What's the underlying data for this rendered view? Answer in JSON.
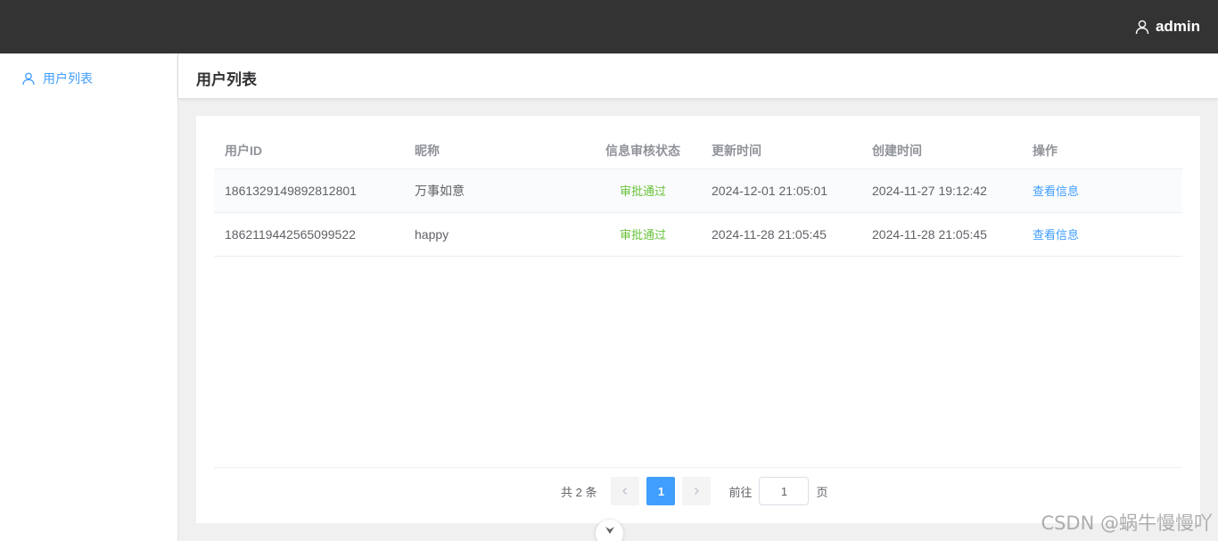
{
  "header": {
    "username": "admin"
  },
  "sidebar": {
    "items": [
      {
        "label": "用户列表",
        "icon": "user-icon"
      }
    ]
  },
  "page": {
    "title": "用户列表"
  },
  "table": {
    "columns": [
      "用户ID",
      "昵称",
      "信息审核状态",
      "更新时间",
      "创建时间",
      "操作"
    ],
    "rows": [
      {
        "id": "1861329149892812801",
        "nickname": "万事如意",
        "status": "审批通过",
        "updated": "2024-12-01 21:05:01",
        "created": "2024-11-27 19:12:42",
        "action": "查看信息"
      },
      {
        "id": "1862119442565099522",
        "nickname": "happy",
        "status": "审批通过",
        "updated": "2024-11-28 21:05:45",
        "created": "2024-11-28 21:05:45",
        "action": "查看信息"
      }
    ]
  },
  "pagination": {
    "total_text": "共 2 条",
    "current_page": "1",
    "goto_label": "前往",
    "goto_value": "1",
    "page_suffix": "页"
  },
  "watermark": "CSDN @蜗牛慢慢吖",
  "colors": {
    "topbar": "#333333",
    "accent": "#409eff",
    "success": "#67c23a"
  }
}
